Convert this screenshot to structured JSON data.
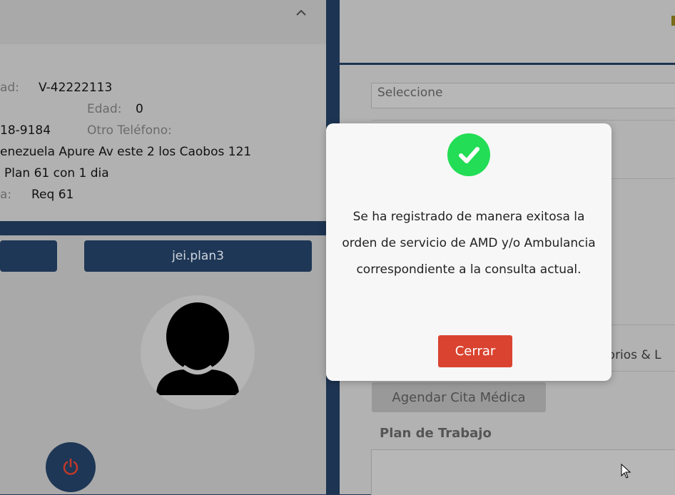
{
  "patient": {
    "id_label": "ad:",
    "id_value": "V-42222113",
    "age_label": "Edad:",
    "age_value": "0",
    "phone_value": "18-9184",
    "other_phone_label": "Otro Teléfono:",
    "address": "enezuela Apure Av este 2 los Caobos 121",
    "plan": "Plan 61 con 1 dia",
    "req_label": "a:",
    "req_value": "Req 61"
  },
  "user_button_label": "jei.plan3",
  "right": {
    "select_placeholder": "Seleccione",
    "tab_partial": "torios & L",
    "agendar_label": "Agendar Cita Médica",
    "plan_trabajo_label": "Plan de Trabajo"
  },
  "modal": {
    "message": "Se ha registrado de manera exitosa la orden de servicio de AMD y/o Ambulancia correspondiente a la consulta actual.",
    "close_label": "Cerrar"
  },
  "icons": {
    "chevron": "chevron-up-icon",
    "avatar": "user-silhouette-icon",
    "power": "power-icon",
    "check": "check-icon",
    "cursor": "mouse-pointer-icon"
  },
  "colors": {
    "navy": "#1d3452",
    "success_green": "#22dd55",
    "close_red": "#d9432f",
    "power_red": "#c0392b"
  }
}
